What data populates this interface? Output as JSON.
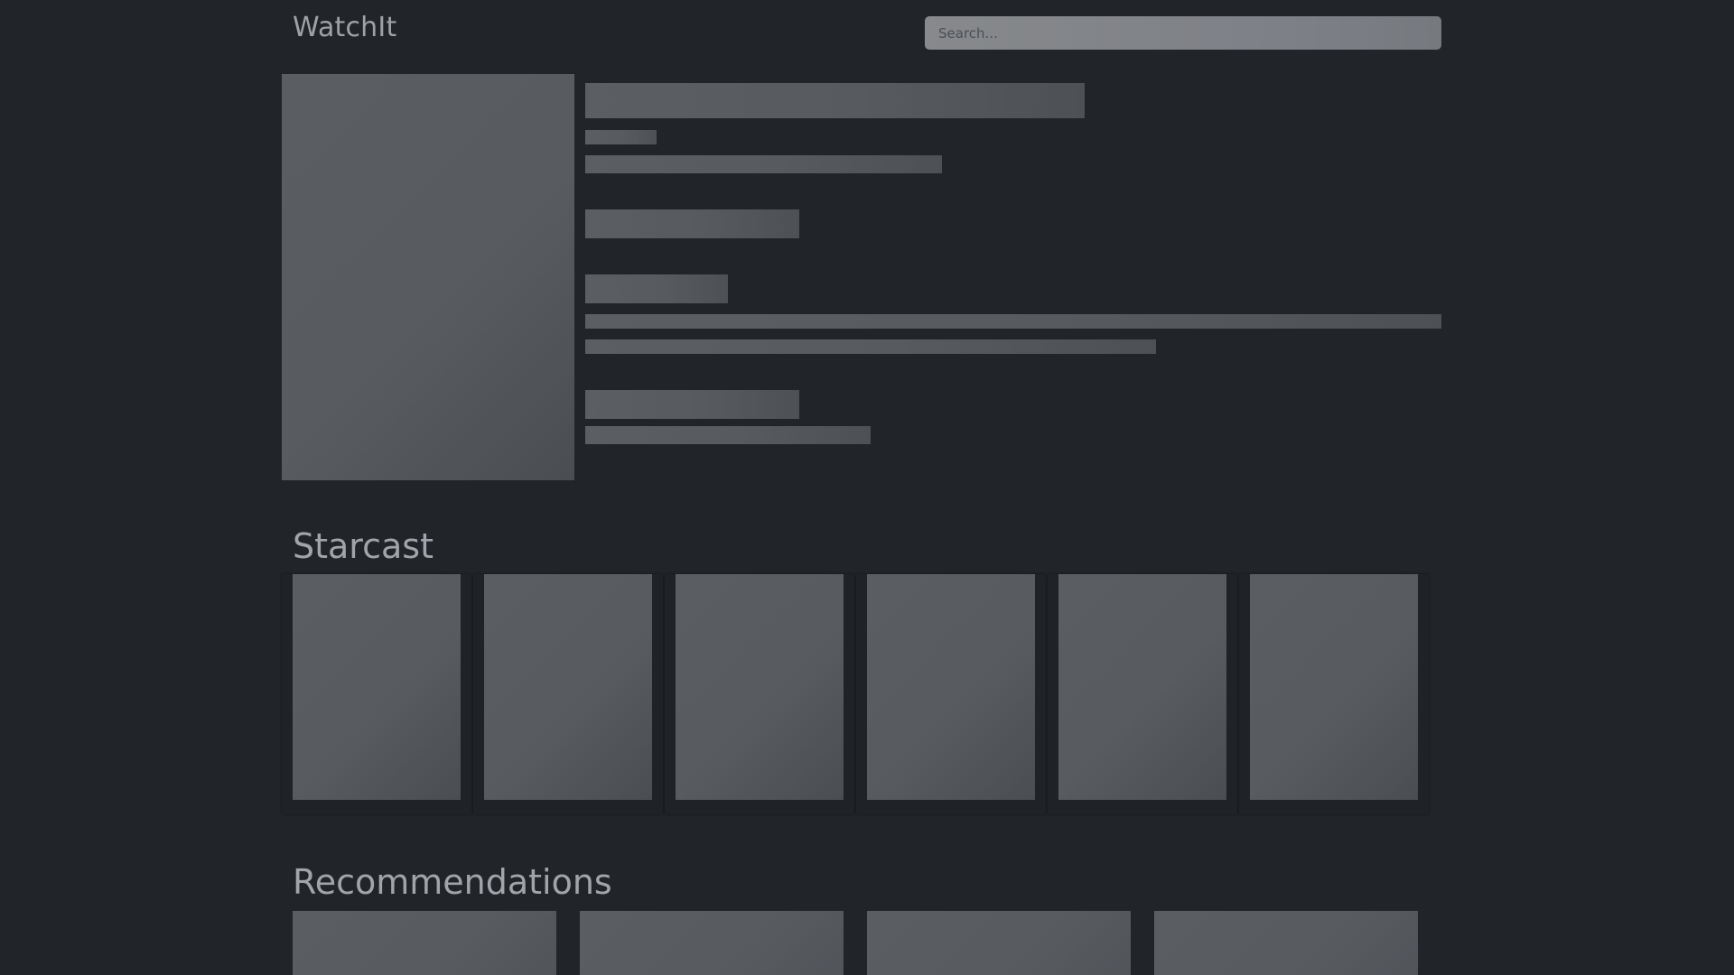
{
  "header": {
    "brand": "WatchIt",
    "search_placeholder": "Search..."
  },
  "sections": {
    "starcast_title": "Starcast",
    "recommendations_title": "Recommendations"
  },
  "colors": {
    "background": "#212429",
    "skeleton": "#595d61",
    "text_muted": "#9ea2a6"
  }
}
